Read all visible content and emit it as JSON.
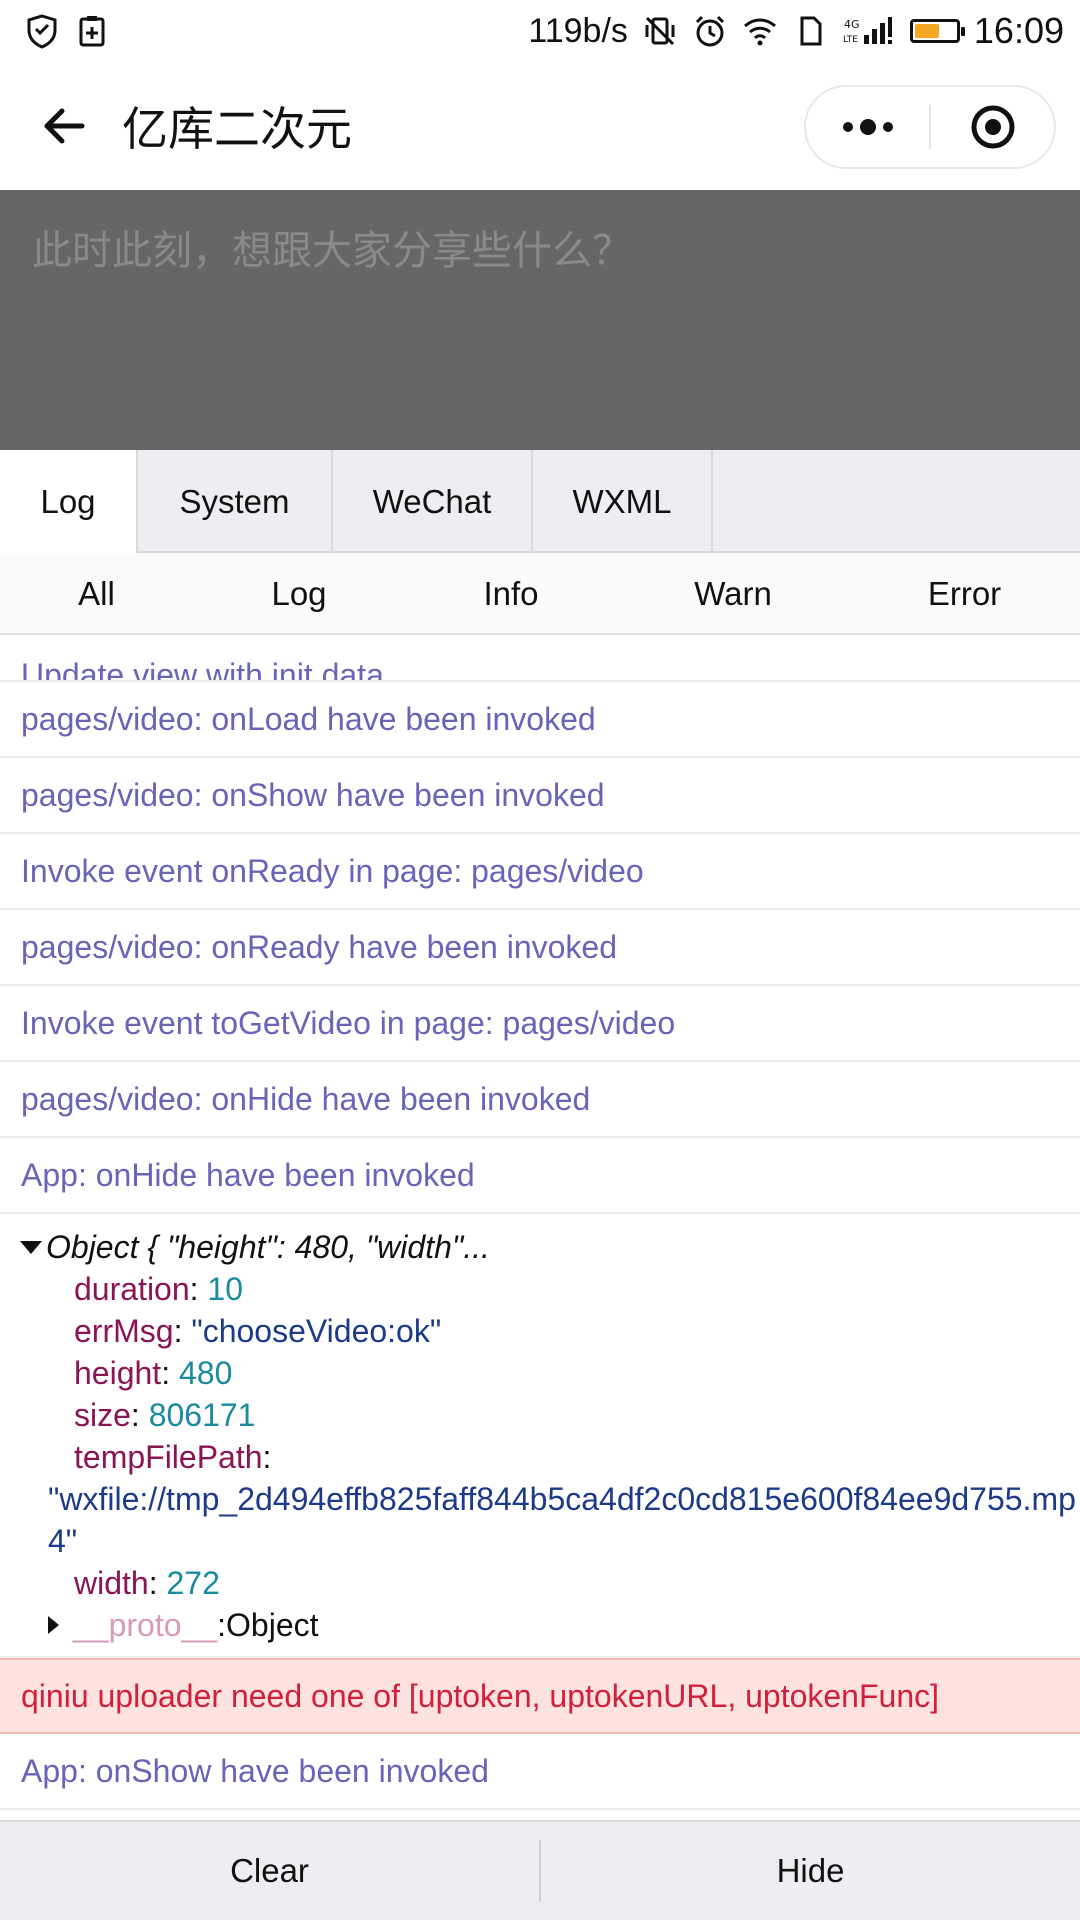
{
  "status_bar": {
    "net_speed": "119b/s",
    "network_label": "4G LTE",
    "time": "16:09",
    "battery_level": 0.55,
    "battery_color": "#f5a623"
  },
  "nav": {
    "back_icon": "arrow-left-icon",
    "title": "亿库二次元",
    "menu_icon": "more-dots-icon",
    "close_icon": "target-circle-icon"
  },
  "post": {
    "placeholder": "此时此刻，想跟大家分享些什么？"
  },
  "console": {
    "tabs": [
      {
        "label": "Log",
        "active": true
      },
      {
        "label": "System",
        "active": false
      },
      {
        "label": "WeChat",
        "active": false
      },
      {
        "label": "WXML",
        "active": false
      }
    ],
    "filters": [
      {
        "label": "All"
      },
      {
        "label": "Log"
      },
      {
        "label": "Info"
      },
      {
        "label": "Warn"
      },
      {
        "label": "Error"
      }
    ],
    "logs_before": [
      "Update view with init data",
      "pages/video: onLoad have been invoked",
      "pages/video: onShow have been invoked",
      "Invoke event onReady in page: pages/video",
      "pages/video: onReady have been invoked",
      "Invoke event toGetVideo in page: pages/video",
      "pages/video: onHide have been invoked",
      "App: onHide have been invoked"
    ],
    "object": {
      "summary": "Object { \"height\": 480, \"width\"...",
      "duration_key": "duration",
      "duration": "10",
      "errMsg_key": "errMsg",
      "errMsg": "\"chooseVideo:ok\"",
      "height_key": "height",
      "height": "480",
      "size_key": "size",
      "size": "806171",
      "tempFilePath_key": "tempFilePath",
      "tempFilePath": "\"wxfile://tmp_2d494effb825faff844b5ca4df2c0cd815e600f84ee9d755.mp4\"",
      "width_key": "width",
      "width": "272",
      "proto_key": "__proto__",
      "proto_value": "Object"
    },
    "error_log": "qiniu uploader need one of [uptoken, uptokenURL, uptokenFunc]",
    "logs_after": [
      "App: onShow have been invoked"
    ],
    "colors": {
      "log_text": "#6a63b8",
      "error_text": "#d3203a",
      "error_bg": "#fde2e0"
    }
  },
  "bottom": {
    "clear_label": "Clear",
    "hide_label": "Hide"
  }
}
